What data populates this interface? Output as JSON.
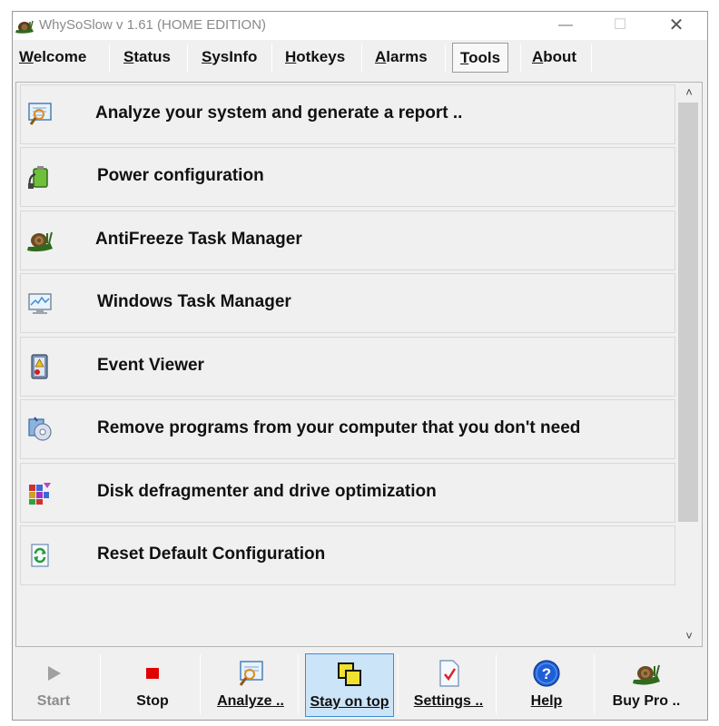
{
  "window": {
    "title": "WhySoSlow v 1.61  (HOME EDITION)",
    "controls": {
      "minimize": "—",
      "maximize": "☐",
      "close": "✕"
    }
  },
  "tabs": [
    {
      "label": "Welcome",
      "active": false
    },
    {
      "label": "Status",
      "active": false
    },
    {
      "label": "SysInfo",
      "active": false
    },
    {
      "label": "Hotkeys",
      "active": false
    },
    {
      "label": "Alarms",
      "active": false
    },
    {
      "label": "Tools",
      "active": true
    },
    {
      "label": "About",
      "active": false
    }
  ],
  "tools": [
    {
      "label": "Analyze your system and generate a report ..",
      "icon": "report-magnifier-icon"
    },
    {
      "label": "Power configuration",
      "icon": "battery-plug-icon"
    },
    {
      "label": "AntiFreeze Task Manager",
      "icon": "snail-icon"
    },
    {
      "label": "Windows Task Manager",
      "icon": "monitor-graph-icon"
    },
    {
      "label": "Event Viewer",
      "icon": "event-log-warning-icon"
    },
    {
      "label": "Remove programs from your computer that you don't need",
      "icon": "uninstall-disc-icon"
    },
    {
      "label": "Disk defragmenter and drive optimization",
      "icon": "defrag-blocks-icon"
    },
    {
      "label": "Reset Default Configuration",
      "icon": "reset-recycle-icon"
    }
  ],
  "scrollbar": {
    "up": "˄",
    "down": "˅"
  },
  "toolbar": {
    "start": {
      "label": "Start",
      "icon": "play-icon",
      "disabled": true
    },
    "stop": {
      "label": "Stop",
      "icon": "stop-icon"
    },
    "analyze": {
      "label": "Analyze ..",
      "icon": "analyze-icon"
    },
    "stay_on_top": {
      "label": "Stay on top",
      "icon": "stay-on-top-icon",
      "pressed": true
    },
    "settings": {
      "label": "Settings ..",
      "icon": "settings-doc-icon"
    },
    "help": {
      "label": "Help",
      "icon": "help-icon"
    },
    "buy_pro": {
      "label": "Buy Pro ..",
      "icon": "snail-icon"
    }
  },
  "colors": {
    "accent_pressed": "#cce4f7",
    "stop_red": "#e00000",
    "help_blue": "#1f5fd6"
  }
}
